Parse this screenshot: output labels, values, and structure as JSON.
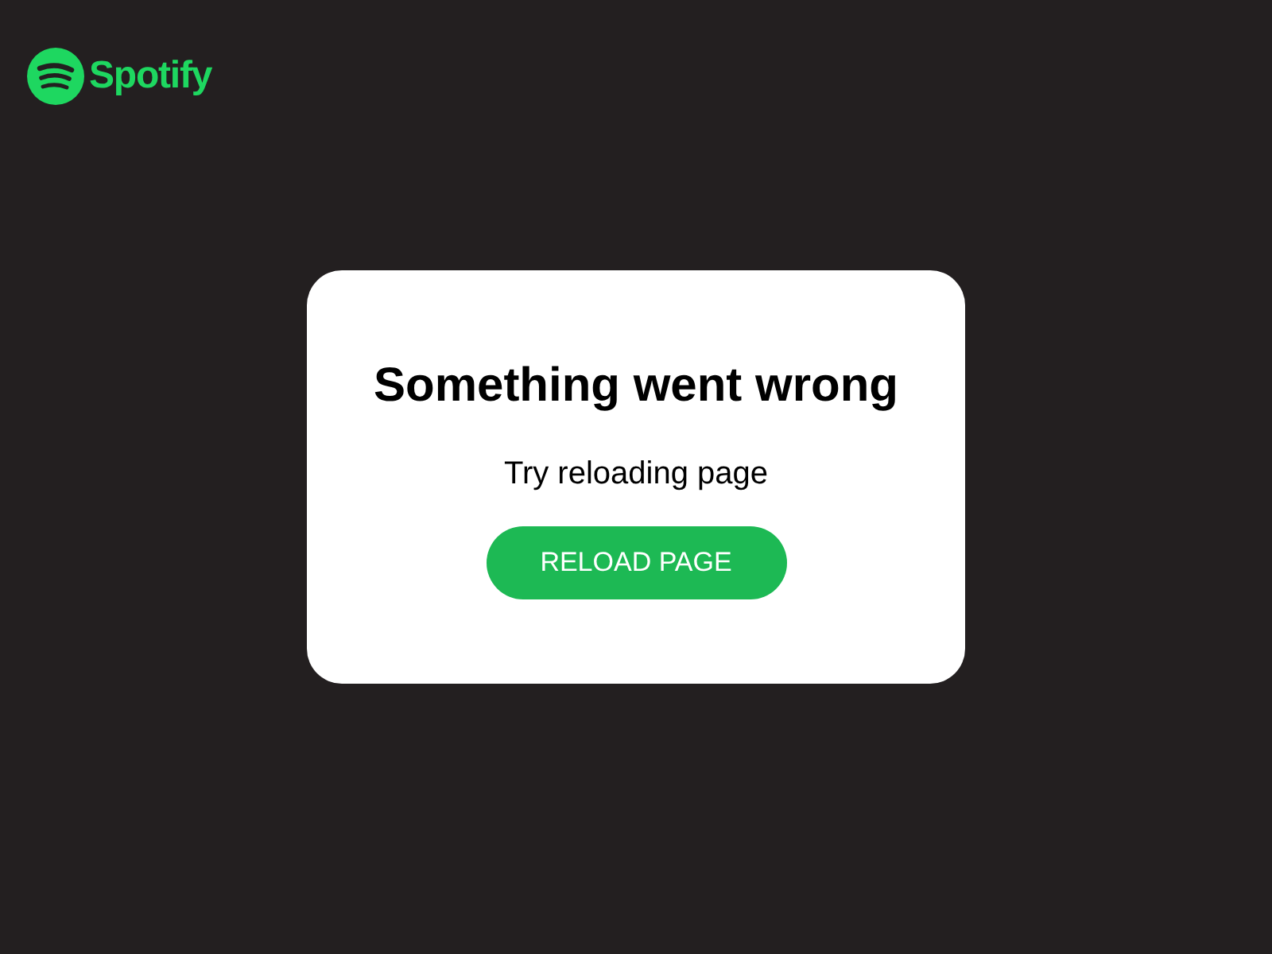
{
  "logo": {
    "text": "Spotify"
  },
  "dialog": {
    "title": "Something went wrong",
    "message": "Try reloading page",
    "button": "RELOAD PAGE"
  }
}
